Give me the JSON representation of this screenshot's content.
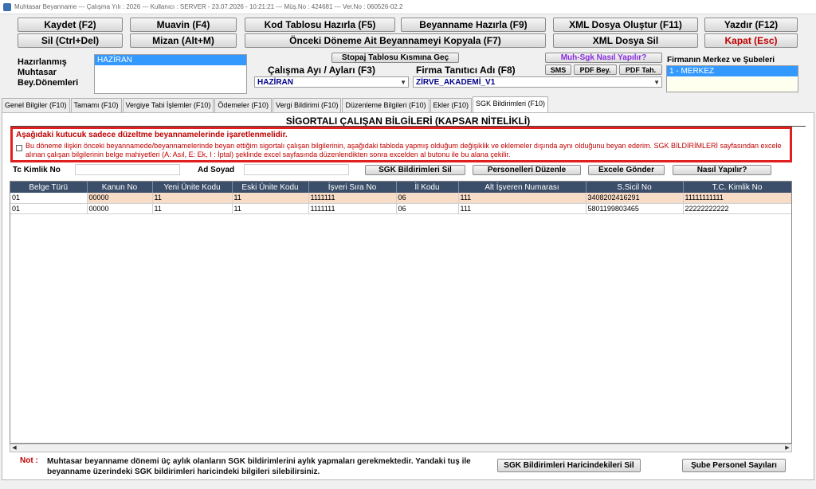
{
  "window": {
    "title": "Muhtasar Beyanname  ---  Çalışma Yılı : 2026  ---  Kullanıcı : SERVER - 23.07.2026 - 10:21:21  ---  Müş.No : 424681  ---  Ver.No : 060526-02.2"
  },
  "toolbar": {
    "kaydet": "Kaydet (F2)",
    "muavin": "Muavin (F4)",
    "kod_tablosu": "Kod Tablosu Hazırla (F5)",
    "beyanname": "Beyanname Hazırla (F9)",
    "xml_olustur": "XML Dosya Oluştur (F11)",
    "yazdir": "Yazdır (F12)",
    "sil": "Sil (Ctrl+Del)",
    "mizan": "Mizan (Alt+M)",
    "onceki_kopyala": "Önceki Döneme Ait Beyannameyi Kopyala (F7)",
    "xml_sil": "XML Dosya Sil",
    "kapat": "Kapat (Esc)"
  },
  "hazirlanmis": {
    "label": "Hazırlanmış Muhtasar Bey.Dönemleri",
    "items": [
      "HAZİRAN"
    ]
  },
  "stopaj_button": "Stopaj Tablosu Kısmına Geç",
  "calisma_ayi": {
    "label": "Çalışma Ayı / Ayları (F3)",
    "value": "HAZİRAN"
  },
  "firma": {
    "label": "Firma Tanıtıcı Adı (F8)",
    "value": "ZİRVE_AKADEMİ_V1"
  },
  "help_buttons": {
    "muh_sgk": "Muh-Sgk Nasıl Yapılır?",
    "sms": "SMS",
    "pdf_bey": "PDF Bey.",
    "pdf_tah": "PDF Tah."
  },
  "firma_merkez": {
    "label": "Firmanın Merkez ve Şubeleri",
    "items": [
      "1 - MERKEZ"
    ]
  },
  "tabs": [
    "Genel Bilgiler (F10)",
    "Tamamı (F10)",
    "Vergiye Tabi İşlemler (F10)",
    "Ödemeler (F10)",
    "Vergi Bildirimi (F10)",
    "Düzenleme Bilgileri (F10)",
    "Ekler (F10)",
    "SGK Bildirimleri (F10)"
  ],
  "section": {
    "title": "SİGORTALI ÇALIŞAN BİLGİLERİ (KAPSAR NİTELİKLİ)"
  },
  "warning": {
    "heading": "Aşağıdaki kutucuk sadece düzeltme beyannamelerinde işaretlenmelidir.",
    "text": "Bu döneme ilişkin önceki beyannamede/beyannamelerinde beyan ettiğim sigortalı çalışan bilgilerinin, aşağıdaki tabloda yapmış olduğum değişiklik ve eklemeler dışında aynı olduğunu beyan ederim. SGK BİLDİRİMLERİ sayfasından excele alınan çalışan bilgilerinin belge mahiyetleri (A: Asıl, E: Ek, I : İptal) şeklinde excel sayfasında düzenlendikten sonra excelden al butonu ile bu alana çekilir."
  },
  "filters": {
    "tc_label": "Tc Kimlik No",
    "ad_label": "Ad Soyad"
  },
  "action_buttons": {
    "sgk_sil": "SGK Bildirimleri Sil",
    "personelleri": "Personelleri Düzenle",
    "excele": "Excele Gönder",
    "nasil": "Nasıl Yapılır?"
  },
  "table": {
    "columns": [
      "Belge Türü",
      "Kanun No",
      "Yeni Ünite Kodu",
      "Eski Ünite Kodu",
      "İşveri Sıra No",
      "İl Kodu",
      "Alt İşveren Numarası",
      "S.Sicil No",
      "T.C. Kimlik No"
    ],
    "rows": [
      [
        "01",
        "00000",
        "11",
        "11",
        "1111111",
        "06",
        "111",
        "3408202416291",
        "11111111111"
      ],
      [
        "01",
        "00000",
        "11",
        "11",
        "1111111",
        "06",
        "111",
        "5801199803465",
        "22222222222"
      ]
    ]
  },
  "note": {
    "label": "Not :",
    "text": "Muhtasar beyanname dönemi üç aylık olanların SGK bildirimlerini aylık yapmaları gerekmektedir. Yandaki tuş ile beyanname üzerindeki SGK bildirimleri haricindeki bilgileri silebilirsiniz."
  },
  "bottom_buttons": {
    "haricindekileri_sil": "SGK Bildirimleri Haricindekileri Sil",
    "sube_personel": "Şube Personel Sayıları"
  }
}
